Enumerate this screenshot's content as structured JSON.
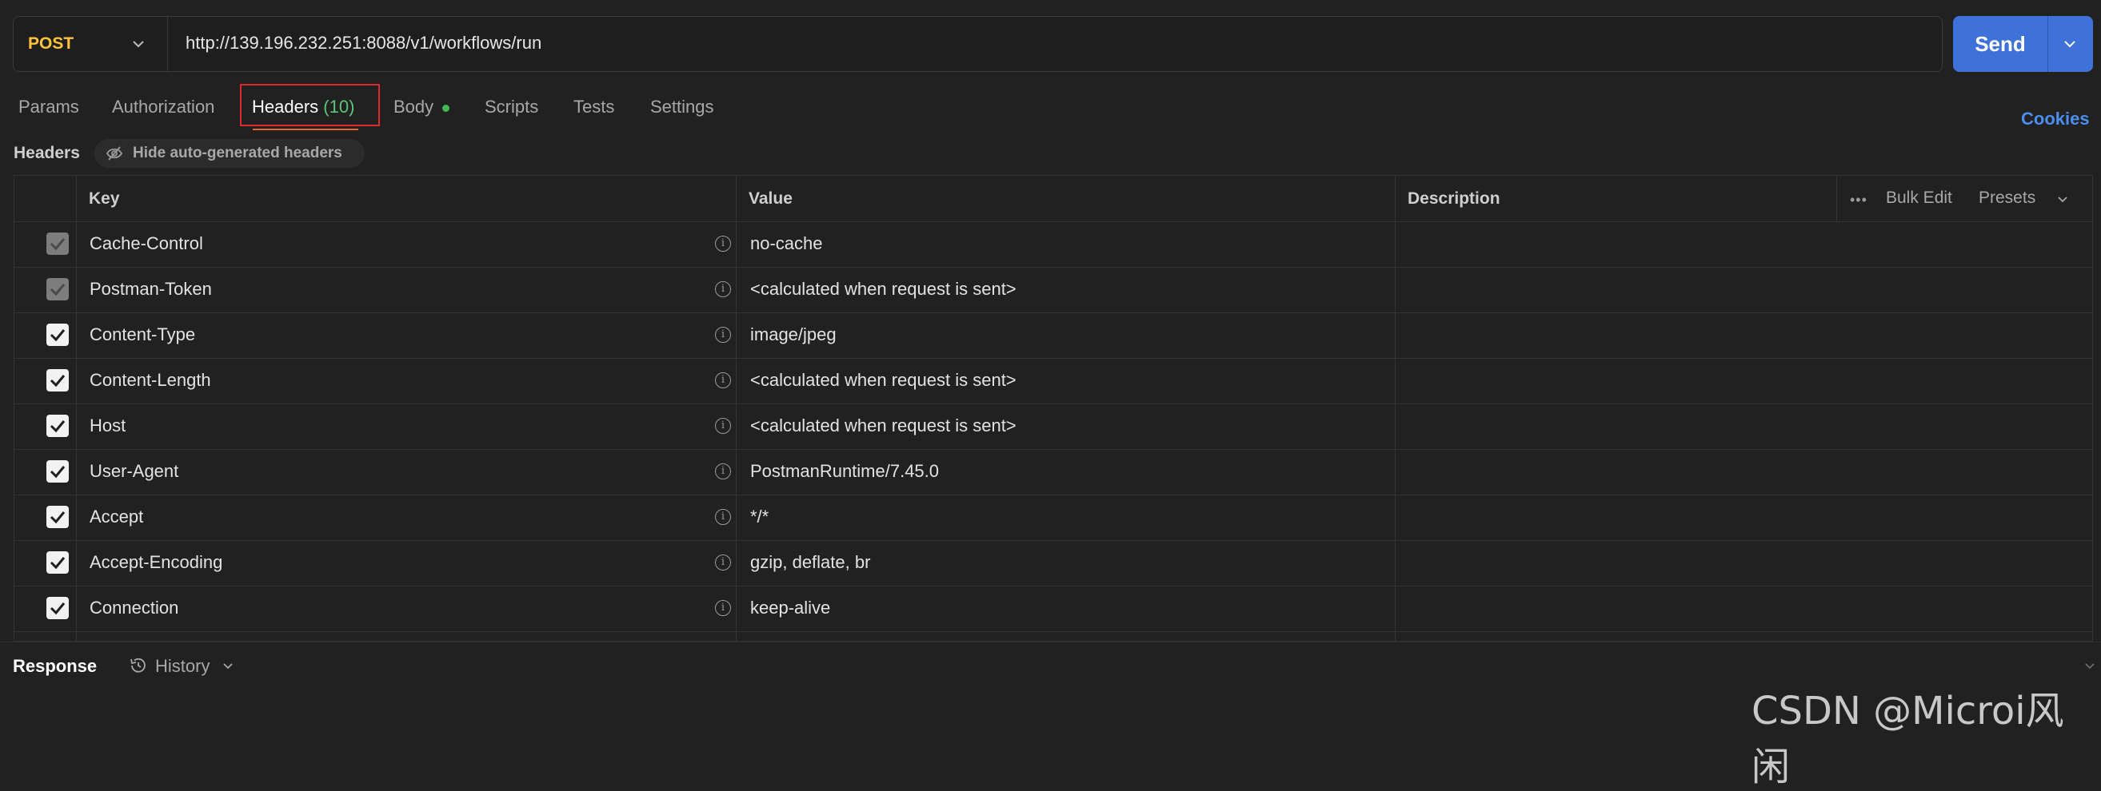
{
  "request": {
    "method": "POST",
    "url": "http://139.196.232.251:8088/v1/workflows/run",
    "send_label": "Send"
  },
  "tabs": [
    {
      "label": "Params"
    },
    {
      "label": "Authorization"
    },
    {
      "label": "Headers",
      "count": "(10)",
      "active": true
    },
    {
      "label": "Body"
    },
    {
      "label": "Scripts"
    },
    {
      "label": "Tests"
    },
    {
      "label": "Settings"
    }
  ],
  "cookies_label": "Cookies",
  "headers_section": {
    "title": "Headers",
    "hide_auto_label": "Hide auto-generated headers"
  },
  "table": {
    "columns": {
      "key": "Key",
      "value": "Value",
      "description": "Description"
    },
    "bulk_edit_label": "Bulk Edit",
    "presets_label": "Presets",
    "rows": [
      {
        "key": "Cache-Control",
        "value": "no-cache",
        "checked": true,
        "disabled": true
      },
      {
        "key": "Postman-Token",
        "value": "<calculated when request is sent>",
        "checked": true,
        "disabled": true
      },
      {
        "key": "Content-Type",
        "value": "image/jpeg",
        "checked": true,
        "disabled": false
      },
      {
        "key": "Content-Length",
        "value": "<calculated when request is sent>",
        "checked": true,
        "disabled": false
      },
      {
        "key": "Host",
        "value": "<calculated when request is sent>",
        "checked": true,
        "disabled": false
      },
      {
        "key": "User-Agent",
        "value": "PostmanRuntime/7.45.0",
        "checked": true,
        "disabled": false
      },
      {
        "key": "Accept",
        "value": "*/*",
        "checked": true,
        "disabled": false
      },
      {
        "key": "Accept-Encoding",
        "value": "gzip, deflate, br",
        "checked": true,
        "disabled": false
      },
      {
        "key": "Connection",
        "value": "keep-alive",
        "checked": true,
        "disabled": false
      }
    ]
  },
  "response_panel": {
    "response_label": "Response",
    "history_label": "History"
  },
  "watermark": "CSDN @Microi风闲",
  "colors": {
    "accent": "#3f72d8",
    "method": "#ffc23c",
    "highlight_box": "#e02a2a",
    "tab_count": "#58c77a",
    "body_dot": "#3fb950",
    "cookies": "#4b8ef0"
  }
}
